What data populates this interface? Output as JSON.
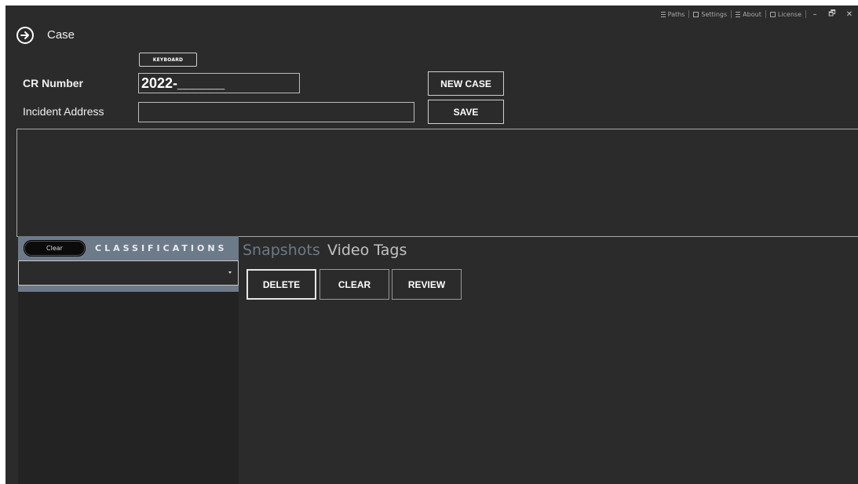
{
  "topbar": {
    "paths": "Paths",
    "settings": "Settings",
    "about": "About",
    "license": "License",
    "minimize": "–",
    "restore": "🗗",
    "close": "✕"
  },
  "header": {
    "title": "Case",
    "keyboard_label": "KEYBOARD"
  },
  "form": {
    "cr_label": "CR Number",
    "cr_value": "2022-______",
    "address_label": "Incident Address",
    "address_value": "",
    "new_case_label": "NEW CASE",
    "save_label": "SAVE"
  },
  "classifications": {
    "clear_label": "Clear",
    "title": "CLASSIFICATIONS",
    "selected": ""
  },
  "tabs": {
    "snapshots": "Snapshots",
    "video_tags": "Video Tags"
  },
  "actions": {
    "delete_label": "DELETE",
    "clear_label": "CLEAR",
    "review_label": "REVIEW"
  },
  "colors": {
    "background": "#2b2b2b",
    "panel_accent": "#6d7a89",
    "text": "#ffffff"
  }
}
